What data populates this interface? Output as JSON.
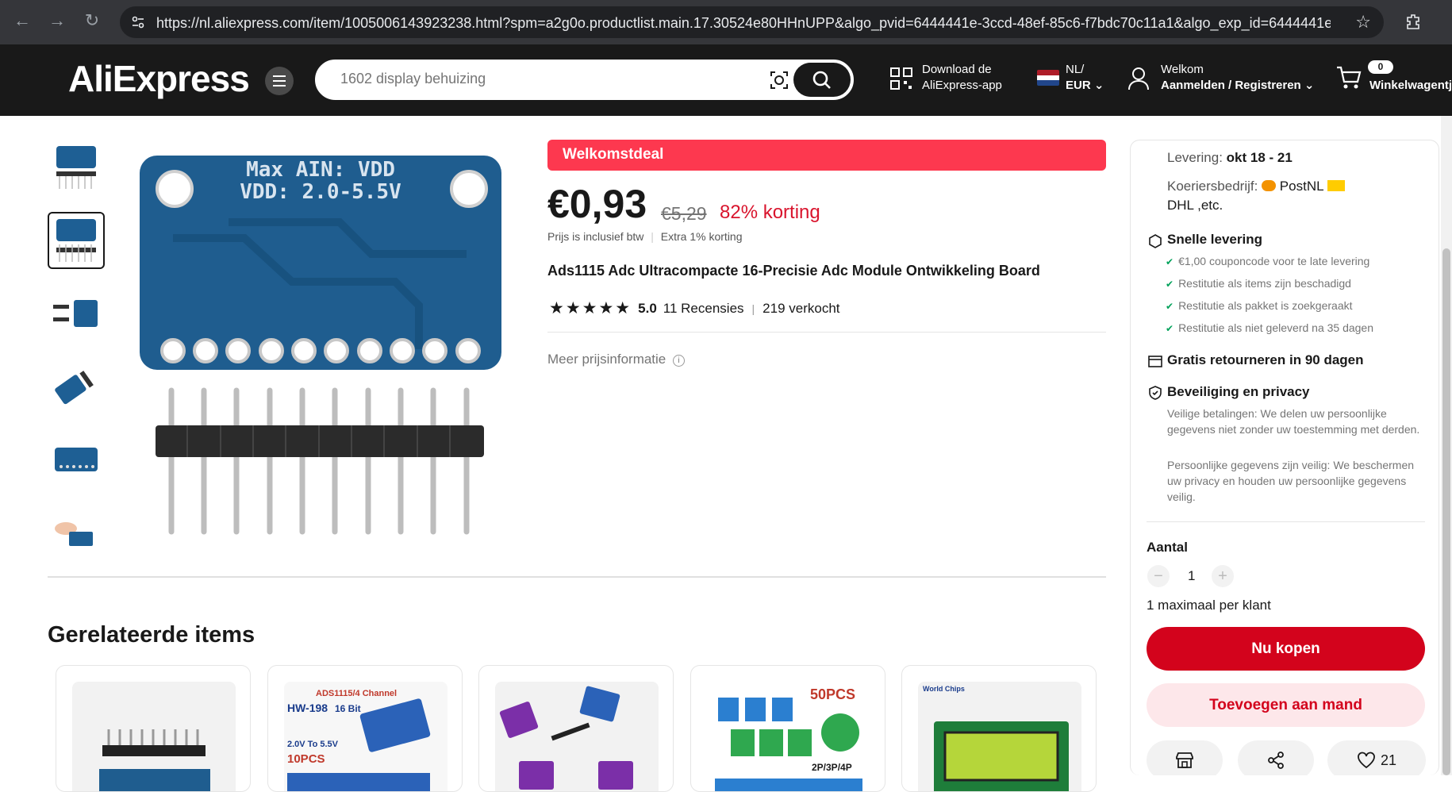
{
  "browser": {
    "url": "https://nl.aliexpress.com/item/1005006143923238.html?spm=a2g0o.productlist.main.17.30524e80HHnUPP&algo_pvid=6444441e-3ccd-48ef-85c6-f7bdc70c11a1&algo_exp_id=6444441e-3ccd-..."
  },
  "header": {
    "logo": "AliExpress",
    "search_placeholder": "1602 display behuizing",
    "app_line1": "Download de",
    "app_line2": "AliExpress-app",
    "lang_line1": "NL/",
    "lang_line2": "EUR",
    "welcome_line1": "Welkom",
    "welcome_line2": "Aanmelden / Registreren",
    "cart_count": "0",
    "cart_label": "Winkelwagentj"
  },
  "product": {
    "deal_banner": "Welkomstdeal",
    "price": "€0,93",
    "old_price": "€5,29",
    "discount": "82% korting",
    "price_note1": "Prijs is inclusief btw",
    "price_note2": "Extra 1% korting",
    "title": "Ads1115 Adc Ultracompacte 16-Precisie Adc Module Ontwikkeling Board",
    "rating": "5.0",
    "reviews": "11 Recensies",
    "sold": "219 verkocht",
    "more_price_info": "Meer prijsinformatie",
    "image_text_1": "Max AIN: VDD",
    "image_text_2": "VDD: 2.0-5.5V"
  },
  "related": {
    "title": "Gerelateerde items",
    "card2_text1": "ADS1115/4 Channel",
    "card2_text2": "HW-198",
    "card2_text3": "16 Bit",
    "card2_text4": "2.0V To 5.5V",
    "card2_text5": "10PCS",
    "card4_text1": "50PCS",
    "card4_text2": "2P/3P/4P",
    "card5_text1": "World Chips"
  },
  "panel": {
    "delivery_label": "Levering:",
    "delivery_value": "okt 18 - 21",
    "courier_label": "Koeriersbedrijf:",
    "courier_value": "PostNL",
    "courier_more": "DHL ,etc.",
    "fast_title": "Snelle levering",
    "fast_items": [
      "€1,00 couponcode voor te late levering",
      "Restitutie als items zijn beschadigd",
      "Restitutie als pakket is zoekgeraakt",
      "Restitutie als niet geleverd na 35 dagen"
    ],
    "returns": "Gratis retourneren in 90 dagen",
    "security_title": "Beveiliging en privacy",
    "security_text1": "Veilige betalingen: We delen uw persoonlijke gegevens niet zonder uw toestemming met derden.",
    "security_text2": "Persoonlijke gegevens zijn veilig: We beschermen uw privacy en houden uw persoonlijke gegevens veilig.",
    "qty_label": "Aantal",
    "qty_value": "1",
    "qty_limit": "1 maximaal per klant",
    "buy_now": "Nu kopen",
    "add_to_cart": "Toevoegen aan mand",
    "wishlist_count": "21"
  },
  "colors": {
    "accent_red": "#d3031c",
    "deal_red": "#fd384f",
    "header_bg": "#191919"
  }
}
